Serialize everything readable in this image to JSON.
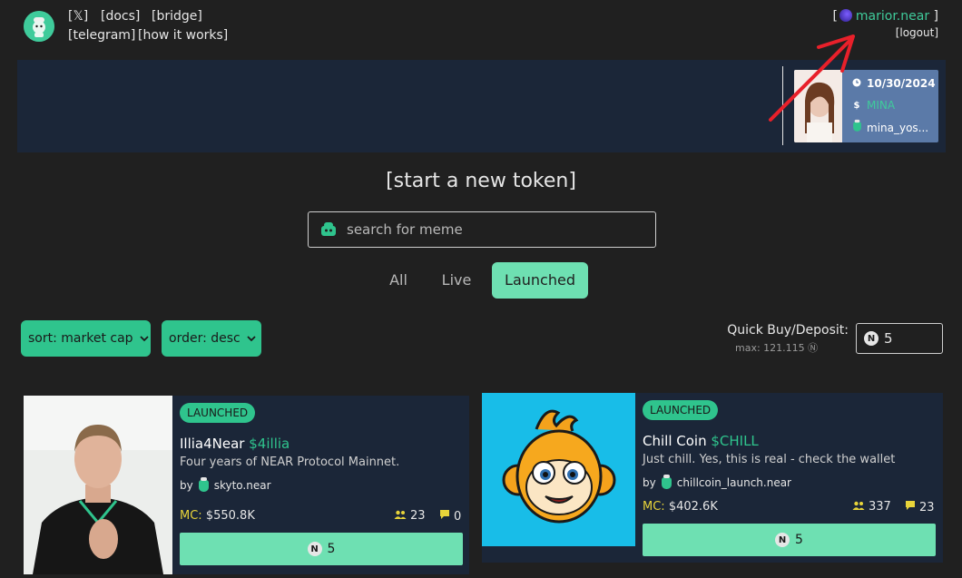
{
  "nav": {
    "x_link": "[𝕏]",
    "docs": "[docs]",
    "bridge": "[bridge]",
    "telegram": "[telegram]",
    "how_it_works": "[how it works]"
  },
  "user": {
    "bracket_open": "[",
    "name": "marior.near",
    "bracket_close": " ]",
    "logout": "[logout]"
  },
  "featured": {
    "date": "10/30/2024",
    "ticker": "MINA",
    "creator": "mina_yos..."
  },
  "start_token": "[start a new token]",
  "search": {
    "placeholder": "search for meme"
  },
  "tabs": [
    {
      "label": "All",
      "active": false
    },
    {
      "label": "Live",
      "active": false
    },
    {
      "label": "Launched",
      "active": true
    }
  ],
  "sort": {
    "label": "sort: market cap"
  },
  "order": {
    "label": "order: desc"
  },
  "quick_buy": {
    "label": "Quick Buy/Deposit:",
    "max": "max: 121.115 Ⓝ",
    "value": "5"
  },
  "cards": [
    {
      "status": "LAUNCHED",
      "name": "Illia4Near",
      "ticker": "$4illia",
      "description": "Four years of NEAR Protocol Mainnet.",
      "by": "by",
      "creator": "skyto.near",
      "mc_label": "MC:",
      "mc_value": "$550.8K",
      "holders": "23",
      "comments": "0",
      "buy_amount": "5"
    },
    {
      "status": "LAUNCHED",
      "name": "Chill Coin",
      "ticker": "$CHILL",
      "description": "Just chill. Yes, this is real - check the wallet",
      "by": "by",
      "creator": "chillcoin_launch.near",
      "mc_label": "MC:",
      "mc_value": "$402.6K",
      "holders": "337",
      "comments": "23",
      "buy_amount": "5"
    }
  ],
  "colors": {
    "background": "#202020",
    "panel": "#1b2638",
    "accent": "#2fc48d",
    "accent_light": "#6ee0b2",
    "mc_label": "#e8d43a",
    "arrow": "#e8202a"
  },
  "icons": {
    "logo": "chef-logo-icon",
    "clock": "clock-icon",
    "dollar": "dollar-icon",
    "holders": "users-icon",
    "comments": "comment-icon",
    "near": "near-icon",
    "chevron": "chevron-down-icon"
  }
}
